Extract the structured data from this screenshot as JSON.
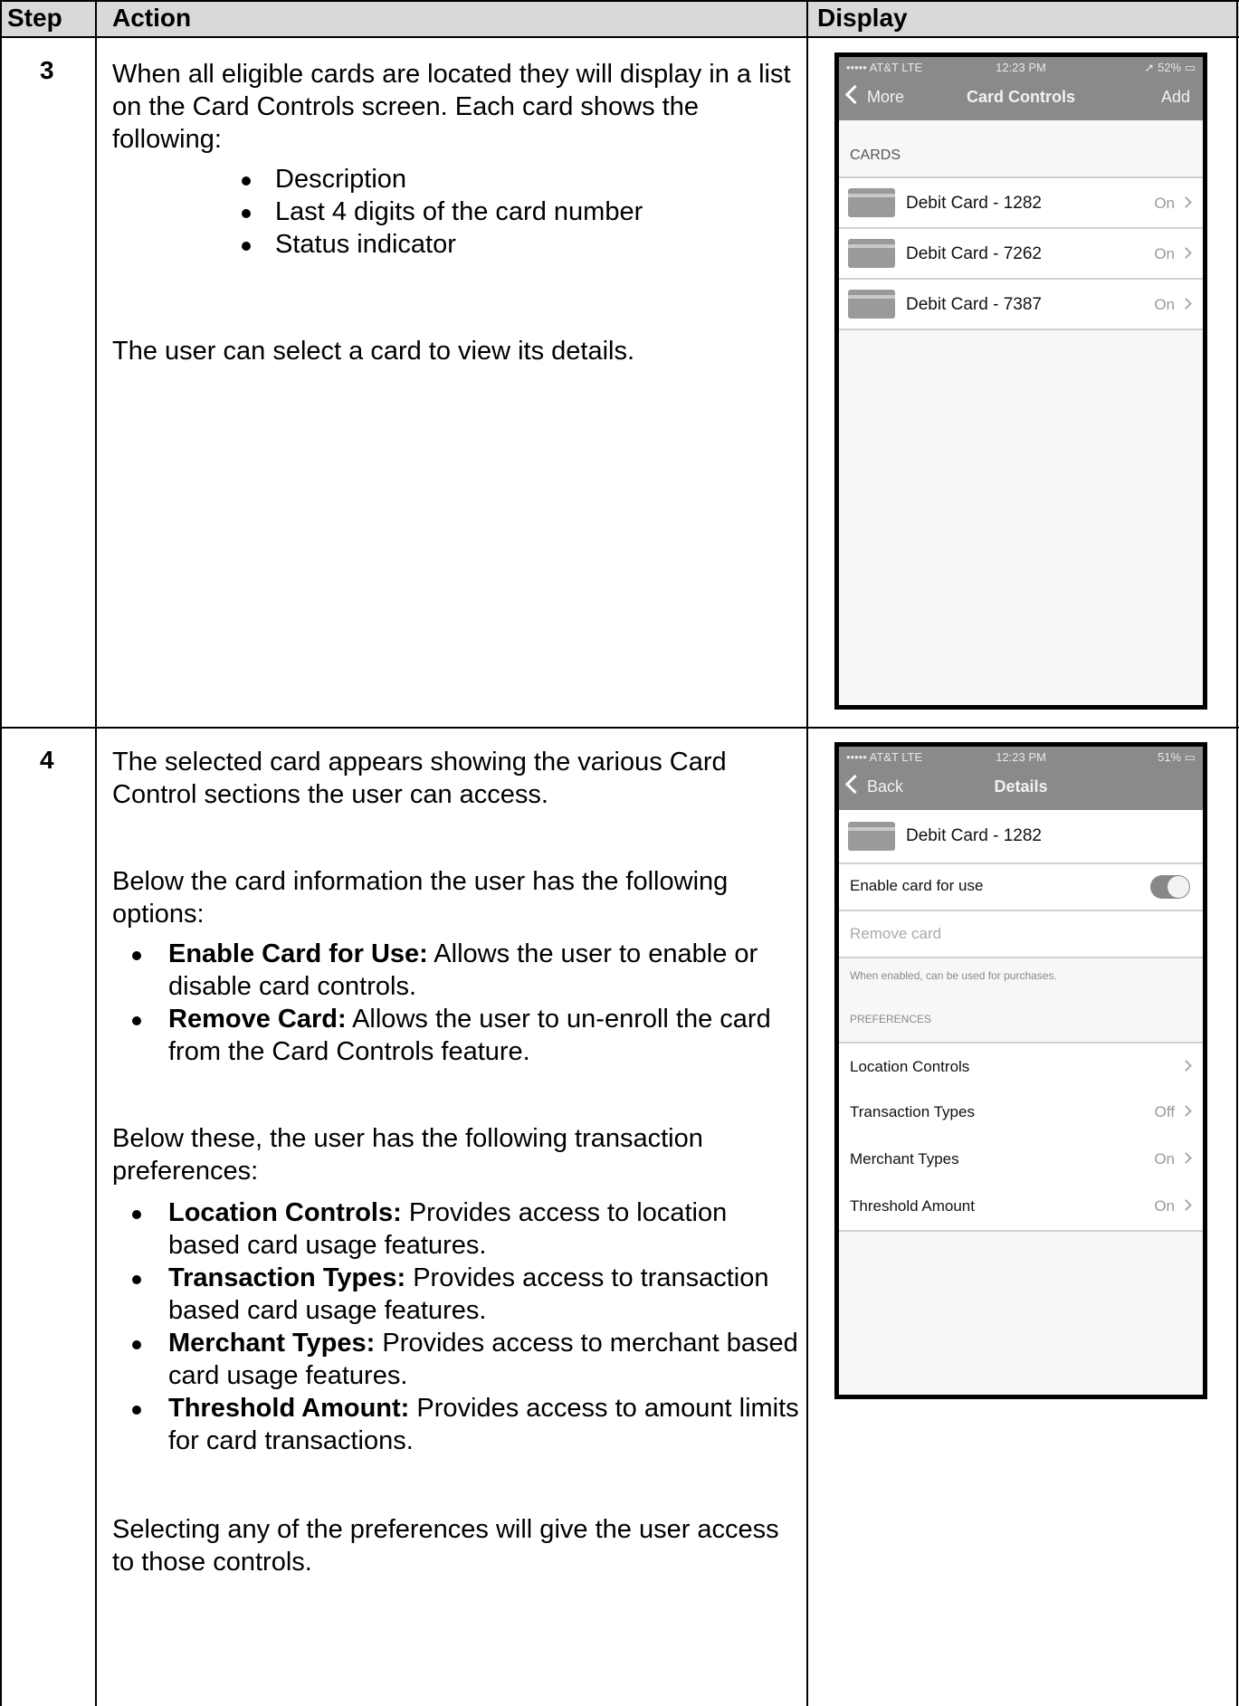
{
  "table": {
    "headers": {
      "step": "Step",
      "action": "Action",
      "display": "Display"
    }
  },
  "step3": {
    "number": "3",
    "intro": "When all eligible cards are located they will display in a list on the Card Controls screen.  Each card shows the following:",
    "bullets": [
      "Description",
      "Last 4 digits of the card number",
      "Status indicator"
    ],
    "closing": "The user can select a card to view its details."
  },
  "step4": {
    "number": "4",
    "intro": "The selected card appears showing the various Card Control sections the user can access.",
    "options_intro": "Below the card information the user has the following options:",
    "options": [
      {
        "term": "Enable Card for Use:",
        "desc": "  Allows the user to enable or disable card controls."
      },
      {
        "term": "Remove Card:",
        "desc": "  Allows the user to un-enroll the card from the Card Controls feature."
      }
    ],
    "prefs_intro": "Below these, the user has the following transaction preferences:",
    "prefs": [
      {
        "term": "Location Controls:",
        "desc": "  Provides access to location based card usage features."
      },
      {
        "term": "Transaction Types:",
        "desc": "  Provides access to transaction based card usage features."
      },
      {
        "term": "Merchant Types:",
        "desc": "  Provides access to merchant based card usage features."
      },
      {
        "term": "Threshold Amount:",
        "desc": "  Provides access to amount limits for card transactions."
      }
    ],
    "closing": "Selecting any of the preferences will give the user access to those controls."
  },
  "screen1": {
    "status": {
      "carrier": "••••• AT&T  LTE",
      "time": "12:23 PM",
      "battery": "➚ 52% ▭"
    },
    "nav": {
      "back": "More",
      "title": "Card Controls",
      "action": "Add"
    },
    "section": "CARDS",
    "cards": [
      {
        "name": "Debit Card - 1282",
        "status": "On"
      },
      {
        "name": "Debit Card - 7262",
        "status": "On"
      },
      {
        "name": "Debit Card - 7387",
        "status": "On"
      }
    ]
  },
  "screen2": {
    "status": {
      "carrier": "••••• AT&T  LTE",
      "time": "12:23 PM",
      "battery": "51% ▭"
    },
    "nav": {
      "back": "Back",
      "title": "Details"
    },
    "card": "Debit Card - 1282",
    "enable_label": "Enable card for use",
    "enable_on": true,
    "remove_label": "Remove card",
    "hint": "When enabled, can be used for purchases.",
    "prefs_header": "PREFERENCES",
    "prefs": [
      {
        "label": "Location Controls",
        "value": ""
      },
      {
        "label": "Transaction Types",
        "value": "Off"
      },
      {
        "label": "Merchant Types",
        "value": "On"
      },
      {
        "label": "Threshold Amount",
        "value": "On"
      }
    ]
  }
}
